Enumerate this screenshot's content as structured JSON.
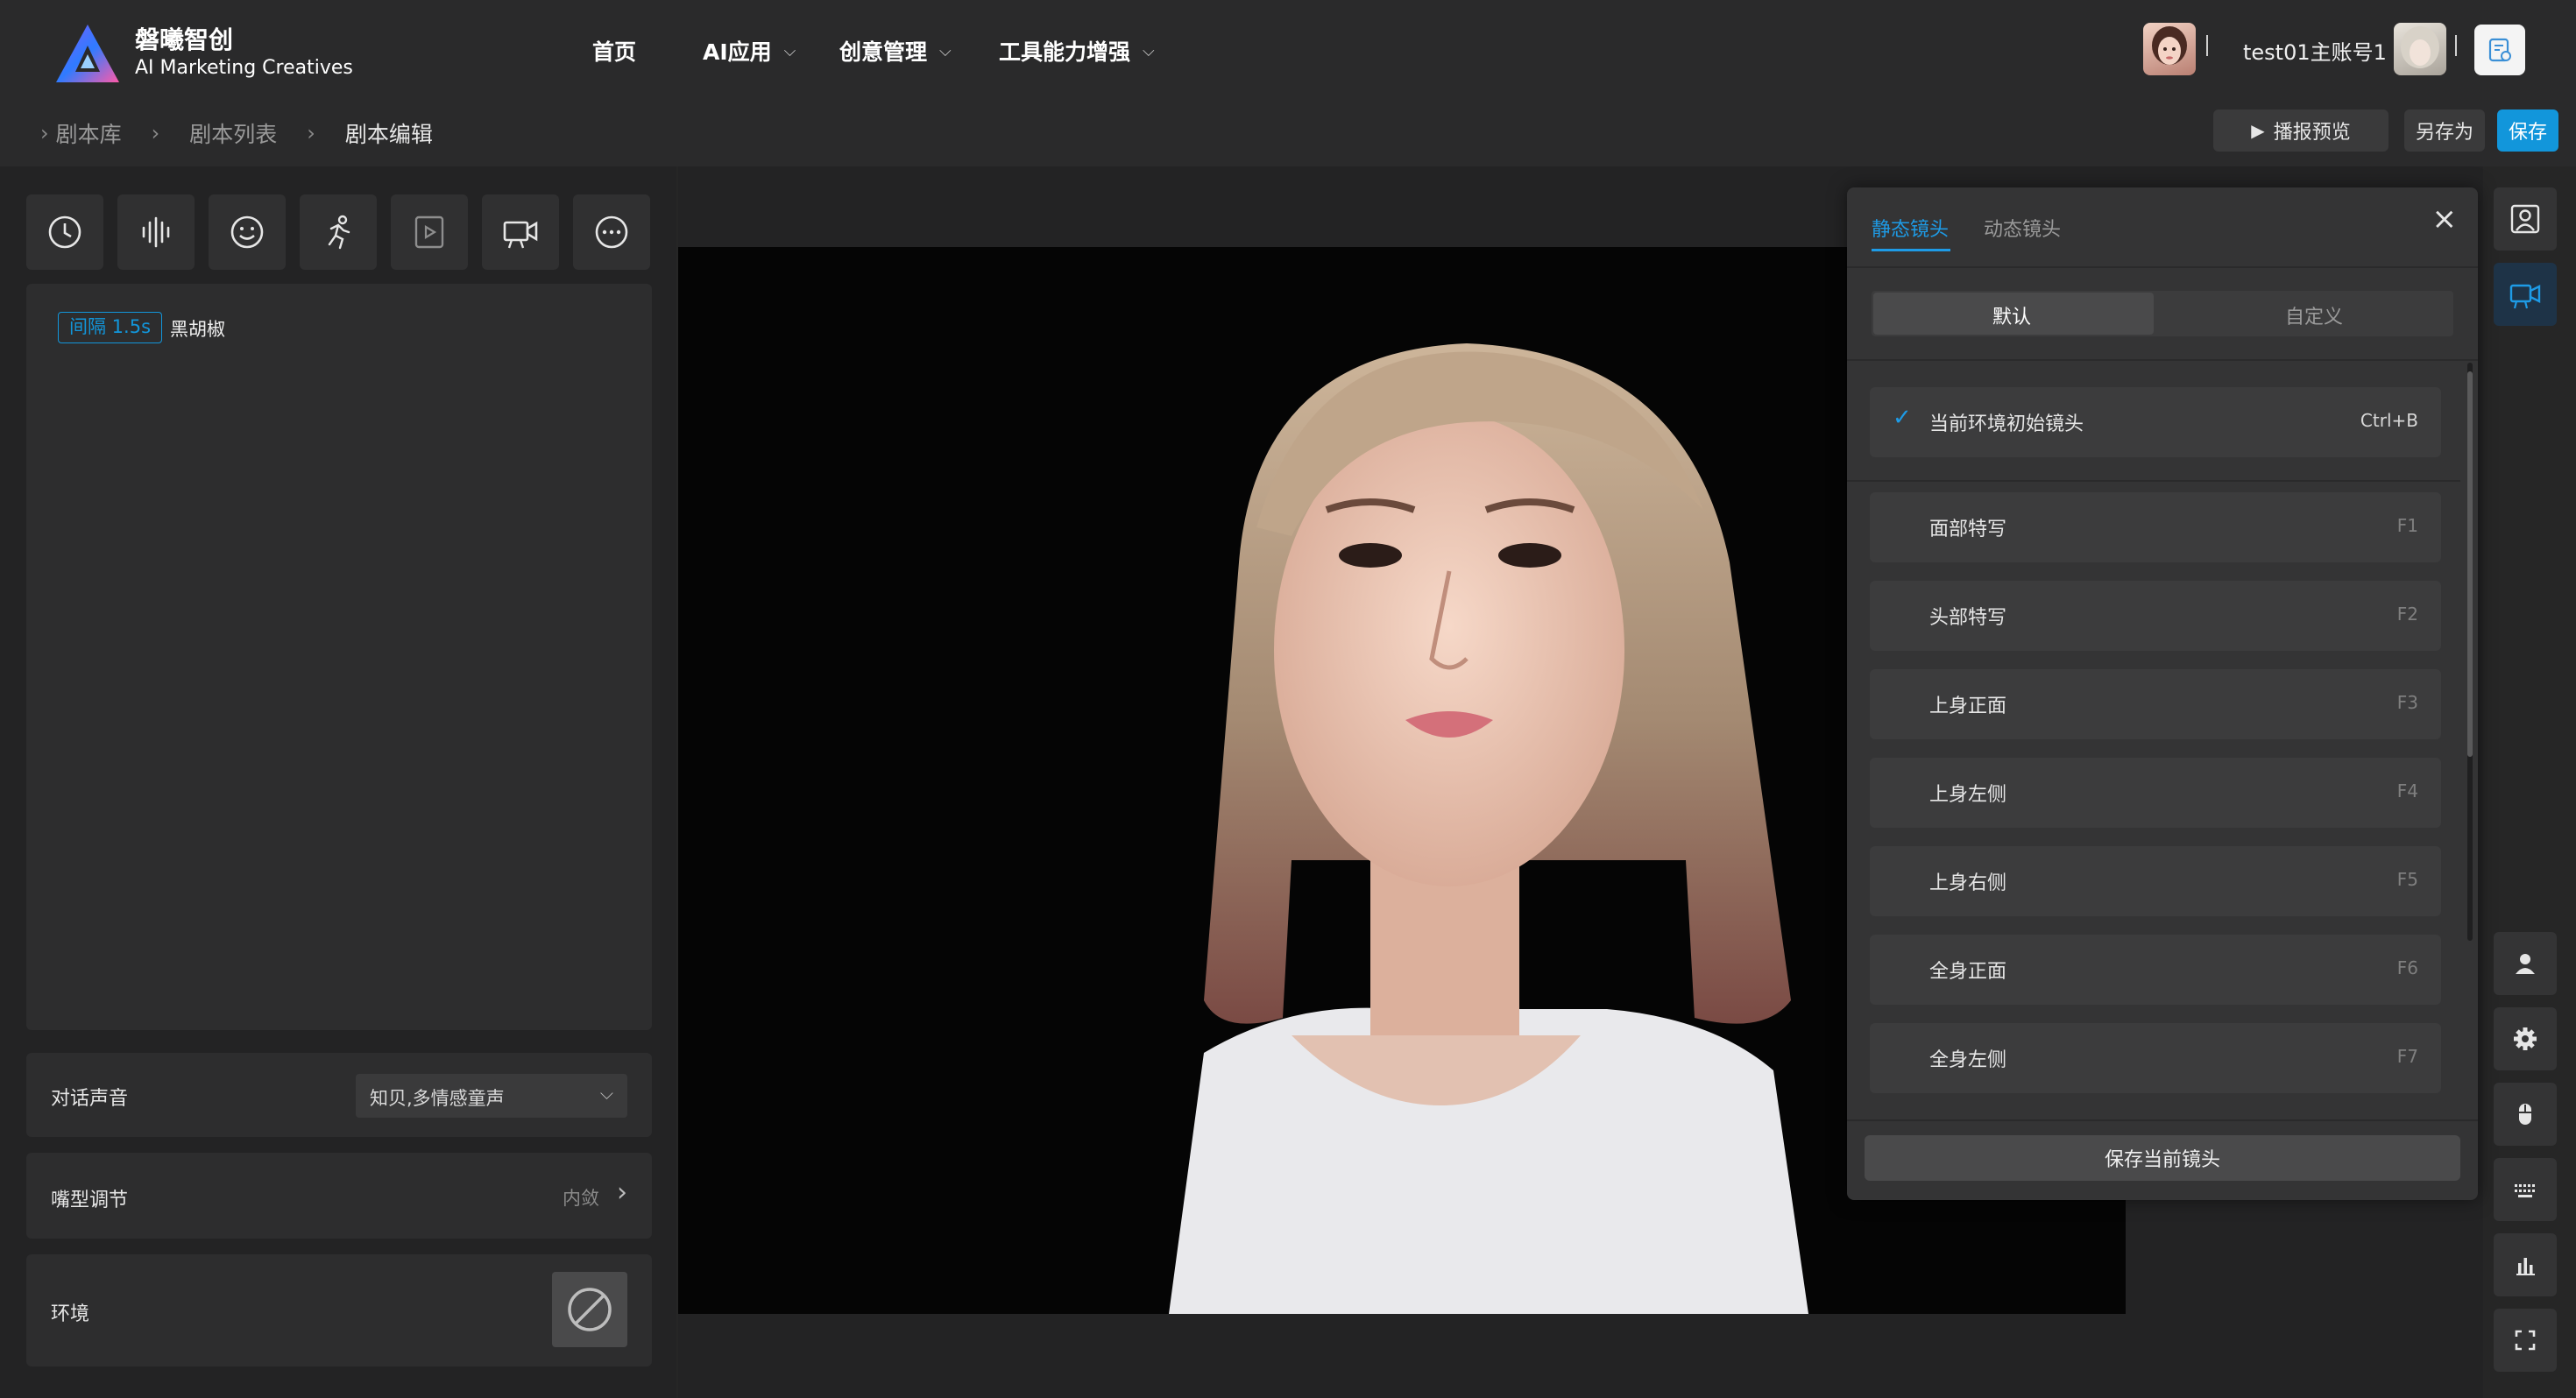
{
  "brand": {
    "name": "磐曦智创",
    "tagline": "AI Marketing Creatives"
  },
  "nav": {
    "items": [
      {
        "label": "首页"
      },
      {
        "label": "AI应用"
      },
      {
        "label": "创意管理"
      },
      {
        "label": "工具能力增强"
      }
    ]
  },
  "account": {
    "name": "test01主账号1"
  },
  "breadcrumb": {
    "items": [
      "剧本库",
      "剧本列表",
      "剧本编辑"
    ]
  },
  "actions": {
    "preview": "播报预览",
    "save_as": "另存为",
    "save": "保存"
  },
  "toolbar": {
    "tools": [
      "clock-icon",
      "audio-wave-icon",
      "smile-icon",
      "running-icon",
      "video-play-icon",
      "camera-icon",
      "more-icon"
    ]
  },
  "script": {
    "interval_tag": "间隔 1.5s",
    "text": "黑胡椒"
  },
  "settings": {
    "voice_label": "对话声音",
    "voice_value": "知贝,多情感童声",
    "mouth_label": "嘴型调节",
    "mouth_value": "内敛",
    "env_label": "环境"
  },
  "camera_panel": {
    "tabs": [
      "静态镜头",
      "动态镜头"
    ],
    "active_tab": "静态镜头",
    "subtabs": [
      "默认",
      "自定义"
    ],
    "active_subtab": "默认",
    "current": {
      "label": "当前环境初始镜头",
      "shortcut": "Ctrl+B"
    },
    "items": [
      {
        "label": "面部特写",
        "shortcut": "F1"
      },
      {
        "label": "头部特写",
        "shortcut": "F2"
      },
      {
        "label": "上身正面",
        "shortcut": "F3"
      },
      {
        "label": "上身左侧",
        "shortcut": "F4"
      },
      {
        "label": "上身右侧",
        "shortcut": "F5"
      },
      {
        "label": "全身正面",
        "shortcut": "F6"
      },
      {
        "label": "全身左侧",
        "shortcut": "F7"
      }
    ],
    "save_button": "保存当前镜头"
  },
  "colors": {
    "accent": "#1296db",
    "bg": "#262626",
    "panel": "#343435"
  }
}
